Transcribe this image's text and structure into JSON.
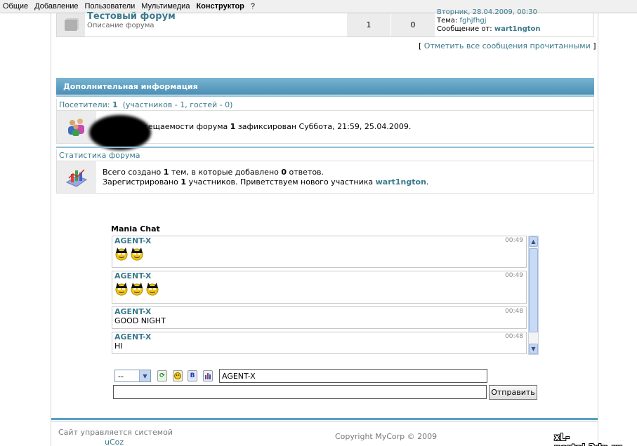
{
  "topbar": {
    "items": [
      "Общие",
      "Добавление",
      "Пользователи",
      "Мультимедиа",
      "Конструктор",
      "?"
    ]
  },
  "forum": {
    "name": "Тестовый форум",
    "description": "Описание форума",
    "topics": "1",
    "replies": "0",
    "last_date": "Вторник, 28.04.2009, 00:30",
    "topic_label": "Тема:",
    "topic_value": "fghjfhgj",
    "message_from_label": "Сообщение от:",
    "message_from_user": "wart1ngton"
  },
  "mark_read": {
    "open": "[",
    "link": "Отметить все сообщения прочитанными",
    "close": "]"
  },
  "info": {
    "header": "Дополнительная информация",
    "visitors_label": "Посетители:",
    "visitors_count": "1",
    "visitors_detail": "(участников - 1, гостей - 0)",
    "record_text_prefix": "Рекорд посещаемости форума",
    "record_count": "1",
    "record_text_suffix": "зафиксирован Суббота, 21:59, 25.04.2009.",
    "stats_label": "Статистика форума",
    "stats_line1_a": "Всего создано",
    "stats_line1_b": "1",
    "stats_line1_c": "тем, в которые добавлено",
    "stats_line1_d": "0",
    "stats_line1_e": "ответов.",
    "stats_line2_a": "Зарегистрировано",
    "stats_line2_b": "1",
    "stats_line2_c": "участников. Приветствуем нового участника",
    "stats_line2_user": "wart1ngton",
    "stats_line2_end": "."
  },
  "chat": {
    "title": "Mania Chat",
    "messages": [
      {
        "nick": "AGENT-X",
        "time": "00:49",
        "text": "",
        "smiles": 2
      },
      {
        "nick": "AGENT-X",
        "time": "00:49",
        "text": "",
        "smiles": 3
      },
      {
        "nick": "AGENT-X",
        "time": "00:48",
        "text": "GOOD NIGHT",
        "smiles": 0
      },
      {
        "nick": "AGENT-X",
        "time": "00:48",
        "text": "HI",
        "smiles": 0
      }
    ],
    "select_value": "--",
    "name_value": "AGENT-X",
    "message_value": "",
    "send_label": "Отправить",
    "bold_btn": "B"
  },
  "footer": {
    "powered_text": "Сайт управляется системой",
    "powered_link": "uCoz",
    "copyright": "Copyright MyCorp © 2009",
    "watermark": "xL-portal.3dn.ru"
  },
  "colors": {
    "link": "#3b7a8c",
    "header_bar": "#5a9fc2"
  }
}
